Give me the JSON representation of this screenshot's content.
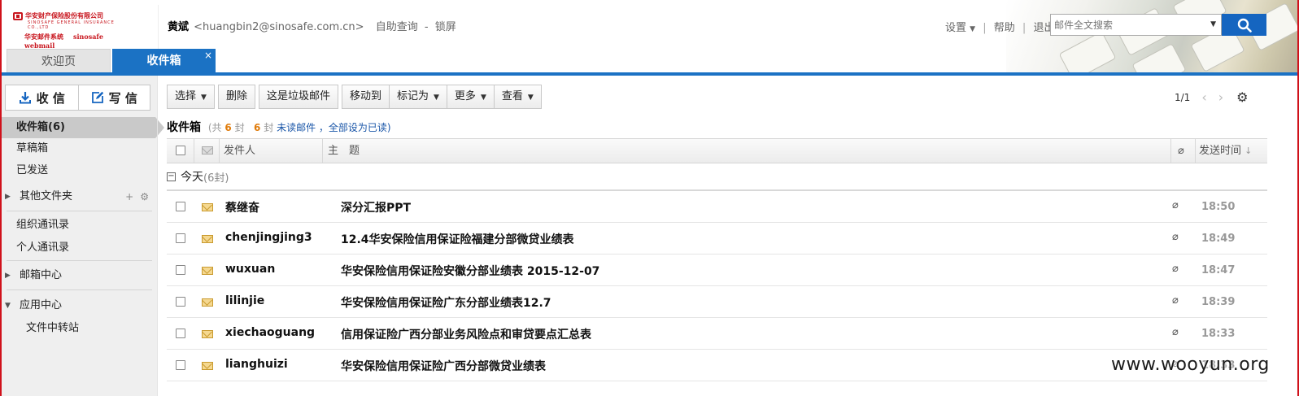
{
  "header": {
    "logo": {
      "cn": "华安财产保险股份有限公司",
      "en": "SINOSAFE GENERAL INSURANCE CO.,LTD",
      "system": "华安邮件系统",
      "webmail": "sinosafe webmail"
    },
    "user_name": "黄斌",
    "user_email": "<huangbin2@sinosafe.com.cn>",
    "self_service": "自助查询",
    "dash": "-",
    "lock": "锁屏",
    "settings": "设置",
    "help": "帮助",
    "logout": "退出",
    "search_placeholder": "邮件全文搜索"
  },
  "tabs": [
    {
      "label": "欢迎页",
      "active": false
    },
    {
      "label": "收件箱",
      "active": true,
      "close": "×"
    }
  ],
  "sidebar": {
    "receive": "收 信",
    "compose": "写 信",
    "inbox": "收件箱(6)",
    "drafts": "草稿箱",
    "sent": "已发送",
    "other_folders": "其他文件夹",
    "org_contacts": "组织通讯录",
    "personal_contacts": "个人通讯录",
    "mailbox_center": "邮箱中心",
    "app_center": "应用中心",
    "file_transfer": "文件中转站"
  },
  "toolbar": {
    "select": "选择",
    "delete": "删除",
    "spam": "这是垃圾邮件",
    "move_to": "移动到",
    "mark_as": "标记为",
    "more": "更多",
    "view": "查看",
    "page": "1/1"
  },
  "folder": {
    "title": "收件箱",
    "total_prefix": "(共",
    "total": "6",
    "unit": "封",
    "unread": "6",
    "unread_label": "未读邮件",
    "mark_all_read": "，全部设为已读)"
  },
  "columns": {
    "from": "发件人",
    "subject": "主　题",
    "time": "发送时间"
  },
  "group": {
    "label": "今天",
    "count": "(6封)"
  },
  "emails": [
    {
      "from": "蔡继奋",
      "subject": "深分汇报PPT",
      "time": "18:50",
      "attachment": true
    },
    {
      "from": "chenjingjing3",
      "subject": "12.4华安保险信用保证险福建分部微贷业绩表",
      "time": "18:49",
      "attachment": true
    },
    {
      "from": "wuxuan",
      "subject": "华安保险信用保证险安徽分部业绩表 2015-12-07",
      "time": "18:47",
      "attachment": true
    },
    {
      "from": "lilinjie",
      "subject": "华安保险信用保证险广东分部业绩表12.7",
      "time": "18:39",
      "attachment": true
    },
    {
      "from": "xiechaoguang",
      "subject": "信用保证险广西分部业务风险点和审贷要点汇总表",
      "time": "18:33",
      "attachment": true
    },
    {
      "from": "lianghuizi",
      "subject": "华安保险信用保证险广西分部微贷业绩表",
      "time": "18:33",
      "attachment": true
    }
  ],
  "watermark": "www.wooyun.org",
  "colors": {
    "accent": "#1b72c4",
    "brand_red": "#c8161e",
    "count_orange": "#e07b0a"
  }
}
